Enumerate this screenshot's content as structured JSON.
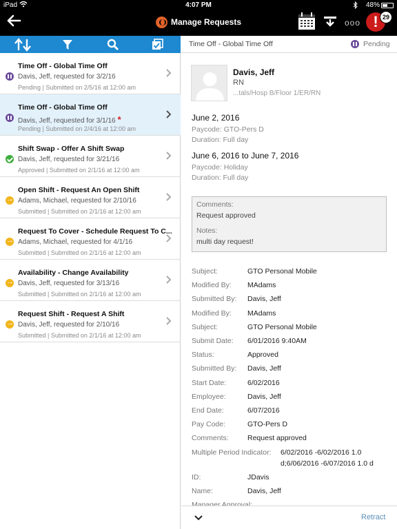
{
  "status_bar": {
    "carrier": "iPad",
    "time": "4:07 PM",
    "battery": "48%"
  },
  "header": {
    "title": "Manage Requests",
    "alert_count": "29",
    "icons": {
      "back": "back-arrow-icon",
      "calendar": "calendar-icon",
      "tray": "tray-download-icon",
      "more": "more-dots-icon",
      "alert": "alert-icon"
    },
    "more_label": "ooo",
    "alert_label": "!"
  },
  "toolbar": {
    "icons": [
      "sort-icon",
      "filter-icon",
      "search-icon",
      "select-all-icon"
    ],
    "accent": "#1e88d0"
  },
  "requests": [
    {
      "title": "Time Off - Global Time Off",
      "subtitle": "Davis, Jeff, requested for 3/2/16",
      "meta": "Pending | Submitted on 2/5/16 at 12:00 am",
      "status": "pending",
      "selected": false,
      "required": ""
    },
    {
      "title": "Time Off - Global Time Off",
      "subtitle": "Davis, Jeff, requested for 3/1/16",
      "meta": "Pending | Submitted on 2/4/16 at 12:00 am",
      "status": "pending",
      "selected": true,
      "required": "*"
    },
    {
      "title": "Shift Swap - Offer A Shift Swap",
      "subtitle": "Davis, Jeff, requested for 3/21/16",
      "meta": "Approved | Submitted on 2/1/16 at 12:00 am",
      "status": "approved",
      "selected": false,
      "required": ""
    },
    {
      "title": "Open Shift - Request An Open Shift",
      "subtitle": "Adams, Michael, requested for 2/10/16",
      "meta": "Submitted | Submitted on 2/1/16 at 12:00 am",
      "status": "submitted",
      "selected": false,
      "required": ""
    },
    {
      "title": "Request To Cover - Schedule Request To C...",
      "subtitle": "Adams, Michael, requested for 4/1/16",
      "meta": "Submitted | Submitted on 2/1/16 at 12:00 am",
      "status": "submitted",
      "selected": false,
      "required": ""
    },
    {
      "title": "Availability - Change Availability",
      "subtitle": "Davis, Jeff, requested for 3/13/16",
      "meta": "Submitted | Submitted on 2/1/16 at 12:00 am",
      "status": "submitted",
      "selected": false,
      "required": ""
    },
    {
      "title": "Request Shift - Request A Shift",
      "subtitle": "Davis, Jeff, requested for 2/10/16",
      "meta": "Submitted | Submitted on 2/1/16 at 12:00 am",
      "status": "submitted",
      "selected": false,
      "required": ""
    }
  ],
  "detail": {
    "header_title": "Time Off - Global Time Off",
    "header_status": "Pending",
    "employee": {
      "name": "Davis, Jeff",
      "role": "RN",
      "location": "...tals/Hosp B/Floor 1/ER/RN"
    },
    "periods": [
      {
        "date": "June 2, 2016",
        "paycode": "Paycode: GTO-Pers D",
        "duration": "Duration: Full day"
      },
      {
        "date": "June 6, 2016 to June 7, 2016",
        "paycode": "Paycode: Holiday",
        "duration": "Duration: Full day"
      }
    ],
    "comments_label": "Comments:",
    "comments_value": "Request approved",
    "notes_label": "Notes:",
    "notes_value": "multi day request!",
    "fields": [
      {
        "label": "Subject:",
        "value": "GTO Personal Mobile"
      },
      {
        "label": "Modified By:",
        "value": "MAdams"
      },
      {
        "label": "Submitted By:",
        "value": "Davis, Jeff"
      },
      {
        "label": "Modified By:",
        "value": "MAdams"
      },
      {
        "label": "Subject:",
        "value": "GTO Personal Mobile"
      },
      {
        "label": "Submit Date:",
        "value": "6/01/2016 9:40AM"
      },
      {
        "label": "Status:",
        "value": "Approved"
      },
      {
        "label": "Submitted By:",
        "value": "Davis, Jeff"
      },
      {
        "label": "Start Date:",
        "value": "6/02/2016"
      },
      {
        "label": "Employee:",
        "value": "Davis, Jeff"
      },
      {
        "label": "End Date:",
        "value": "6/07/2016"
      },
      {
        "label": "Pay Code:",
        "value": "GTO-Pers D"
      },
      {
        "label": "Comments:",
        "value": "Request approved"
      },
      {
        "label": "Multiple Period Indicator:",
        "value": "6/02/2016 -6/02/2016 1.0 d;6/06/2016 -6/07/2016 1.0 d"
      },
      {
        "label": "ID:",
        "value": "JDavis"
      },
      {
        "label": "Name:",
        "value": "Davis, Jeff"
      },
      {
        "label": "Manager Approval:",
        "value": ""
      }
    ],
    "retract_label": "Retract"
  }
}
